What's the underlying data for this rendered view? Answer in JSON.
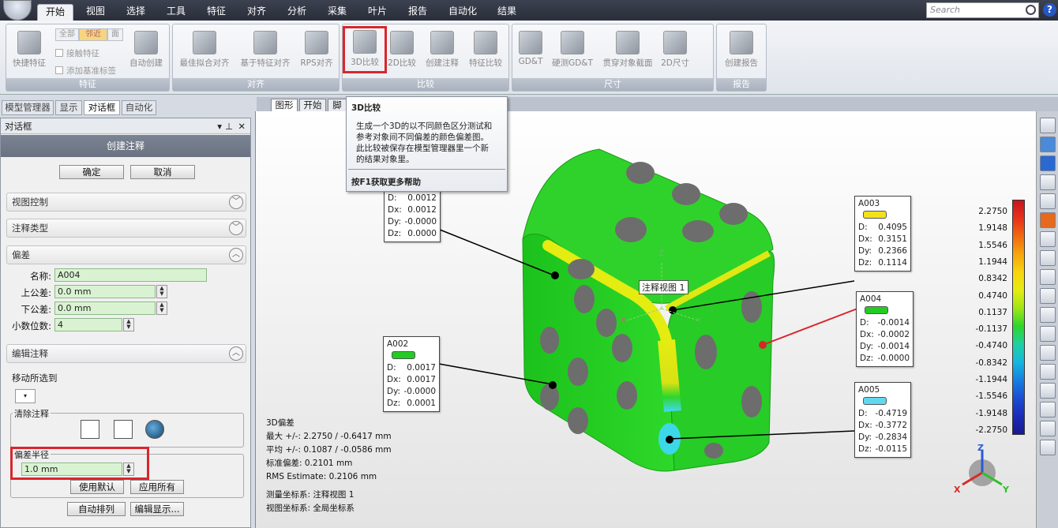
{
  "menu": {
    "tabs": [
      "开始",
      "视图",
      "选择",
      "工具",
      "特征",
      "对齐",
      "分析",
      "采集",
      "叶片",
      "报告",
      "自动化",
      "结果"
    ],
    "active": "开始",
    "search_placeholder": "Search",
    "help": "?"
  },
  "ribbon": {
    "groups": {
      "features": {
        "label": "特征",
        "quick_feature": "快捷特征",
        "seg_all": "全部",
        "seg_near": "邻近",
        "seg_face": "面",
        "contact_feature": "接触特征",
        "add_datum_label": "添加基准标签",
        "auto_create": "自动创建"
      },
      "align": {
        "label": "对齐",
        "best_fit": "最佳拟合对齐",
        "feature_align": "基于特征对齐",
        "rps_align": "RPS对齐"
      },
      "compare": {
        "label": "比较",
        "compare_3d": "3D比较",
        "compare_2d": "2D比较",
        "create_annotation": "创建注释",
        "feature_compare": "特征比较"
      },
      "dimension": {
        "label": "尺寸",
        "gdt": "GD&T",
        "probe_gdt": "硬测GD&T",
        "through_section": "贯穿对象截面",
        "dim_2d": "2D尺寸"
      },
      "report": {
        "label": "报告",
        "create_report": "创建报告"
      }
    }
  },
  "left_tabs": [
    "模型管理器",
    "显示",
    "对话框",
    "自动化"
  ],
  "left_tabs_active": "对话框",
  "dialog": {
    "title": "对话框",
    "header": "创建注释",
    "ok": "确定",
    "cancel": "取消",
    "sections": {
      "view_control": "视图控制",
      "annotation_type": "注释类型",
      "deviation": "偏差",
      "edit_annotation": "编辑注释"
    },
    "name_label": "名称:",
    "name_value": "A004",
    "upper_tol_label": "上公差:",
    "upper_tol_value": "0.0 mm",
    "lower_tol_label": "下公差:",
    "lower_tol_value": "0.0 mm",
    "decimals_label": "小数位数:",
    "decimals_value": "4",
    "move_to_label": "移动所选到",
    "clear_annotation_label": "清除注释",
    "deviation_radius_label": "偏差半径",
    "deviation_radius_value": "1.0 mm",
    "use_default": "使用默认",
    "apply_all": "应用所有",
    "auto_arrange": "自动排列",
    "edit_display": "编辑显示..."
  },
  "view_tabs": [
    "图形",
    "开始",
    "脚"
  ],
  "view_tabs_active": "图形",
  "tooltip": {
    "title": "3D比较",
    "body_lines": [
      "生成一个3D的以不同颜色区分测试和",
      "参考对象间不同偏差的颜色偏差图。",
      "此比较被保存在模型管理器里一个新",
      "的结果对象里。"
    ],
    "footer": "按F1获取更多帮助"
  },
  "annotations": [
    {
      "id": "A001",
      "rows": [
        [
          "D:",
          "0.0012"
        ],
        [
          "Dx:",
          "0.0012"
        ],
        [
          "Dy:",
          "-0.0000"
        ],
        [
          "Dz:",
          "0.0000"
        ]
      ],
      "color": ""
    },
    {
      "id": "A002",
      "rows": [
        [
          "D:",
          "0.0017"
        ],
        [
          "Dx:",
          "0.0017"
        ],
        [
          "Dy:",
          "-0.0000"
        ],
        [
          "Dz:",
          "0.0001"
        ]
      ],
      "color": "#22cc22"
    },
    {
      "id": "A003",
      "rows": [
        [
          "D:",
          "0.4095"
        ],
        [
          "Dx:",
          "0.3151"
        ],
        [
          "Dy:",
          "0.2366"
        ],
        [
          "Dz:",
          "0.1114"
        ]
      ],
      "color": "#f2e21a"
    },
    {
      "id": "A004",
      "rows": [
        [
          "D:",
          "-0.0014"
        ],
        [
          "Dx:",
          "-0.0002"
        ],
        [
          "Dy:",
          "-0.0014"
        ],
        [
          "Dz:",
          "-0.0000"
        ]
      ],
      "color": "#22cc22"
    },
    {
      "id": "A005",
      "rows": [
        [
          "D:",
          "-0.4719"
        ],
        [
          "Dx:",
          "-0.3772"
        ],
        [
          "Dy:",
          "-0.2834"
        ],
        [
          "Dz:",
          "-0.0115"
        ]
      ],
      "color": "#5fd8f0"
    }
  ],
  "annotation_view_label": "注释视图 1",
  "axes": {
    "x": "X",
    "y": "Y",
    "z": "Z"
  },
  "stats": {
    "title": "3D偏差",
    "max": "最大 +/-: 2.2750 / -0.6417 mm",
    "avg": "平均 +/-: 0.1087 / -0.0586 mm",
    "std": "标准偏差: 0.2101 mm",
    "rms": "RMS Estimate: 0.2106 mm",
    "measure_cs": "测量坐标系: 注释视图 1",
    "view_cs": "视图坐标系: 全局坐标系"
  },
  "color_scale": {
    "labels": [
      "2.2750",
      "1.9148",
      "1.5546",
      "1.1944",
      "0.8342",
      "0.4740",
      "0.1137",
      "-0.1137",
      "-0.4740",
      "-0.8342",
      "-1.1944",
      "-1.5546",
      "-1.9148",
      "-2.2750"
    ],
    "colors": [
      "#c8141e",
      "#e8321a",
      "#f06a12",
      "#f6a60c",
      "#f8d40e",
      "#e4ec12",
      "#9ee616",
      "#2ed62a",
      "#1fd0a0",
      "#14b8e0",
      "#1680e0",
      "#1a4ed2",
      "#1b2cb8",
      "#1a1a90"
    ]
  }
}
